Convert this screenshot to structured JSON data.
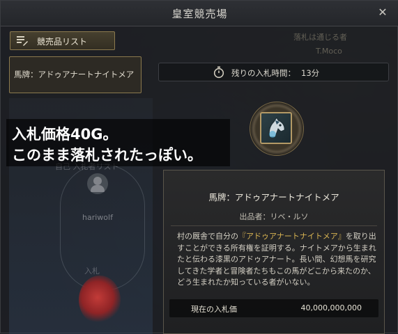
{
  "window": {
    "title": "皇室競売場",
    "close_icon": "close-icon"
  },
  "left": {
    "list_button_label": "競売品リスト",
    "list_icon": "list-edit-icon",
    "selected_item_label": "馬牌：アドゥアナートナイトメア",
    "faded_heading": "自己 入札者リスト",
    "bidder_name": "hariwolf",
    "faded_bottom": "入札"
  },
  "right_faded": {
    "line1": "落札は通じる者",
    "line2": "T.Moco"
  },
  "timer": {
    "label": "残りの入札時間：",
    "value": "13分",
    "icon": "stopwatch-icon"
  },
  "overlay": {
    "line1": "入札価格40G。",
    "line2": "このまま落札されたっぽい。"
  },
  "item": {
    "icon": "horse-head-icon",
    "name": "馬牌：アドゥアナートナイトメア",
    "seller": "出品者：リベ・ルソ",
    "desc_pre": "村の厩舎で自分の",
    "desc_highlight": "『アドゥアナートナイトメア』",
    "desc_post": "を取り出すことができる所有権を証明する。ナイトメアから生まれたと伝わる漆黒のアドゥアナート。長い間、幻想馬を研究してきた学者と冒険者たちもこの馬がどこから来たのか、どう生まれたか知っている者がいない。",
    "price_label": "現在の入札価",
    "price_value": "40,000,000,000"
  },
  "colors": {
    "accent_gold": "#d9b452",
    "border_gold": "#8c7a4e"
  }
}
